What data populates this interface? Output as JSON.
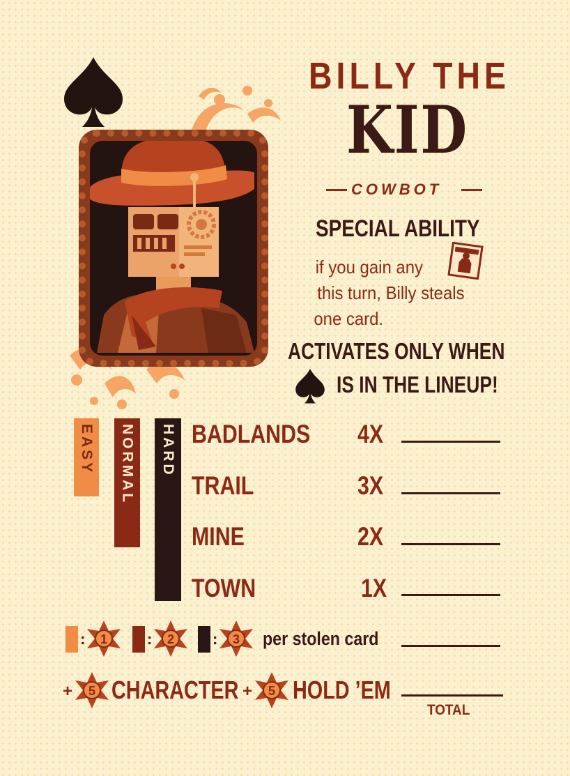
{
  "card": {
    "title_line1": "BILLY THE",
    "title_line2": "KID",
    "subtitle": "COWBOT",
    "suit_icon": "spade-icon"
  },
  "ability": {
    "heading": "SPECIAL ABILITY",
    "lines": [
      "if you gain any",
      "this turn, Billy steals",
      "one card."
    ],
    "wanted_icon": "wanted-poster-icon"
  },
  "activation": {
    "line1": "ACTIVATES ONLY WHEN",
    "line2": "IS IN THE LINEUP!"
  },
  "difficulty": {
    "easy": "EASY",
    "normal": "NORMAL",
    "hard": "HARD",
    "colors": {
      "easy": "#f08c45",
      "normal": "#8a2a16",
      "hard": "#2a1614"
    }
  },
  "rows": [
    {
      "label": "BADLANDS",
      "multiplier": "4X"
    },
    {
      "label": "TRAIL",
      "multiplier": "3X"
    },
    {
      "label": "MINE",
      "multiplier": "2X"
    },
    {
      "label": "TOWN",
      "multiplier": "1X"
    }
  ],
  "stolen": {
    "badges": [
      "1",
      "2",
      "3"
    ],
    "text": "per stolen card"
  },
  "bonus": {
    "plus": "+",
    "character_points": "5",
    "character_label": "CHARACTER",
    "holdem_points": "5",
    "holdem_label": "HOLD ’EM",
    "total_label": "TOTAL"
  }
}
